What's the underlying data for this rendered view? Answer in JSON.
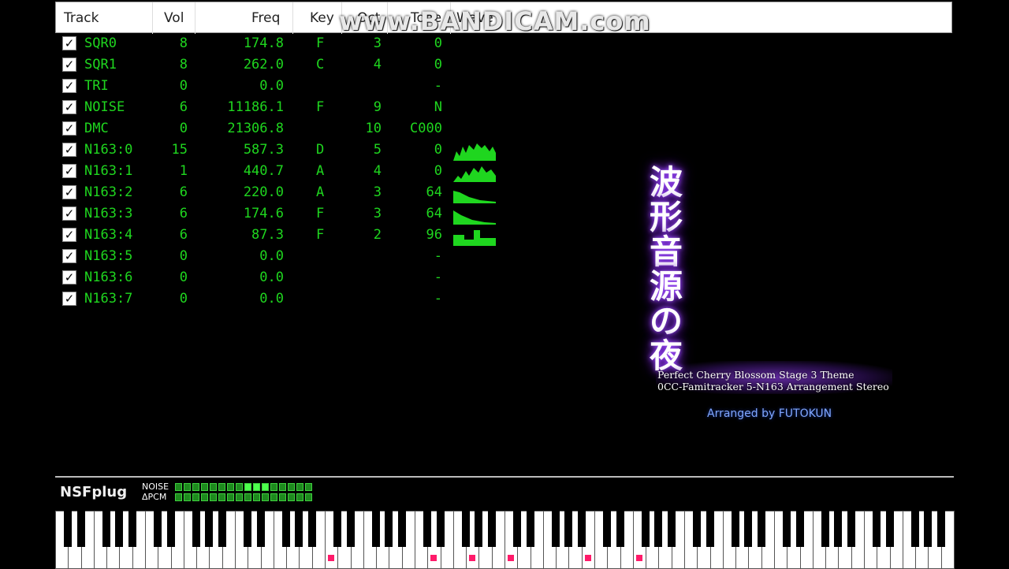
{
  "header": {
    "track": "Track",
    "vol": "Vol",
    "freq": "Freq",
    "key": "Key",
    "oct": "Oct",
    "tone": "Tone",
    "wave": "Wave"
  },
  "tracks": [
    {
      "name": "SQR0",
      "vol": "8",
      "freq": "174.8",
      "key": "F",
      "oct": "3",
      "tone": "0"
    },
    {
      "name": "SQR1",
      "vol": "8",
      "freq": "262.0",
      "key": "C",
      "oct": "4",
      "tone": "0"
    },
    {
      "name": "TRI",
      "vol": "0",
      "freq": "0.0",
      "key": "",
      "oct": "",
      "tone": "-"
    },
    {
      "name": "NOISE",
      "vol": "6",
      "freq": "11186.1",
      "key": "F",
      "oct": "9",
      "tone": "N"
    },
    {
      "name": "DMC",
      "vol": "0",
      "freq": "21306.8",
      "key": "",
      "oct": "10",
      "tone": "C000"
    },
    {
      "name": "N163:0",
      "vol": "15",
      "freq": "587.3",
      "key": "D",
      "oct": "5",
      "tone": "0"
    },
    {
      "name": "N163:1",
      "vol": "1",
      "freq": "440.7",
      "key": "A",
      "oct": "4",
      "tone": "0"
    },
    {
      "name": "N163:2",
      "vol": "6",
      "freq": "220.0",
      "key": "A",
      "oct": "3",
      "tone": "64"
    },
    {
      "name": "N163:3",
      "vol": "6",
      "freq": "174.6",
      "key": "F",
      "oct": "3",
      "tone": "64"
    },
    {
      "name": "N163:4",
      "vol": "6",
      "freq": "87.3",
      "key": "F",
      "oct": "2",
      "tone": "96"
    },
    {
      "name": "N163:5",
      "vol": "0",
      "freq": "0.0",
      "key": "",
      "oct": "",
      "tone": "-"
    },
    {
      "name": "N163:6",
      "vol": "0",
      "freq": "0.0",
      "key": "",
      "oct": "",
      "tone": "-"
    },
    {
      "name": "N163:7",
      "vol": "0",
      "freq": "0.0",
      "key": "",
      "oct": "",
      "tone": "-"
    }
  ],
  "watermark": "www.BANDICAM.com",
  "art": {
    "kanji": [
      "波",
      "形",
      "音",
      "源",
      "の",
      "夜"
    ],
    "subtitle1": "Perfect Cherry Blossom Stage 3 Theme",
    "subtitle2": "0CC-Famitracker 5-N163 Arrangement Stereo",
    "credit": "Arranged by FUTOKUN"
  },
  "bottom": {
    "logo": "NSFplug",
    "meter1_label": "NOISE",
    "meter2_label": "ΔPCM"
  },
  "colors": {
    "track_text": "#1fd61f",
    "wave": "#1fd61f",
    "pressed_key": "#ff1a6a",
    "glow": "#7a2ad8"
  },
  "icons": {
    "checkbox": "check-icon"
  }
}
